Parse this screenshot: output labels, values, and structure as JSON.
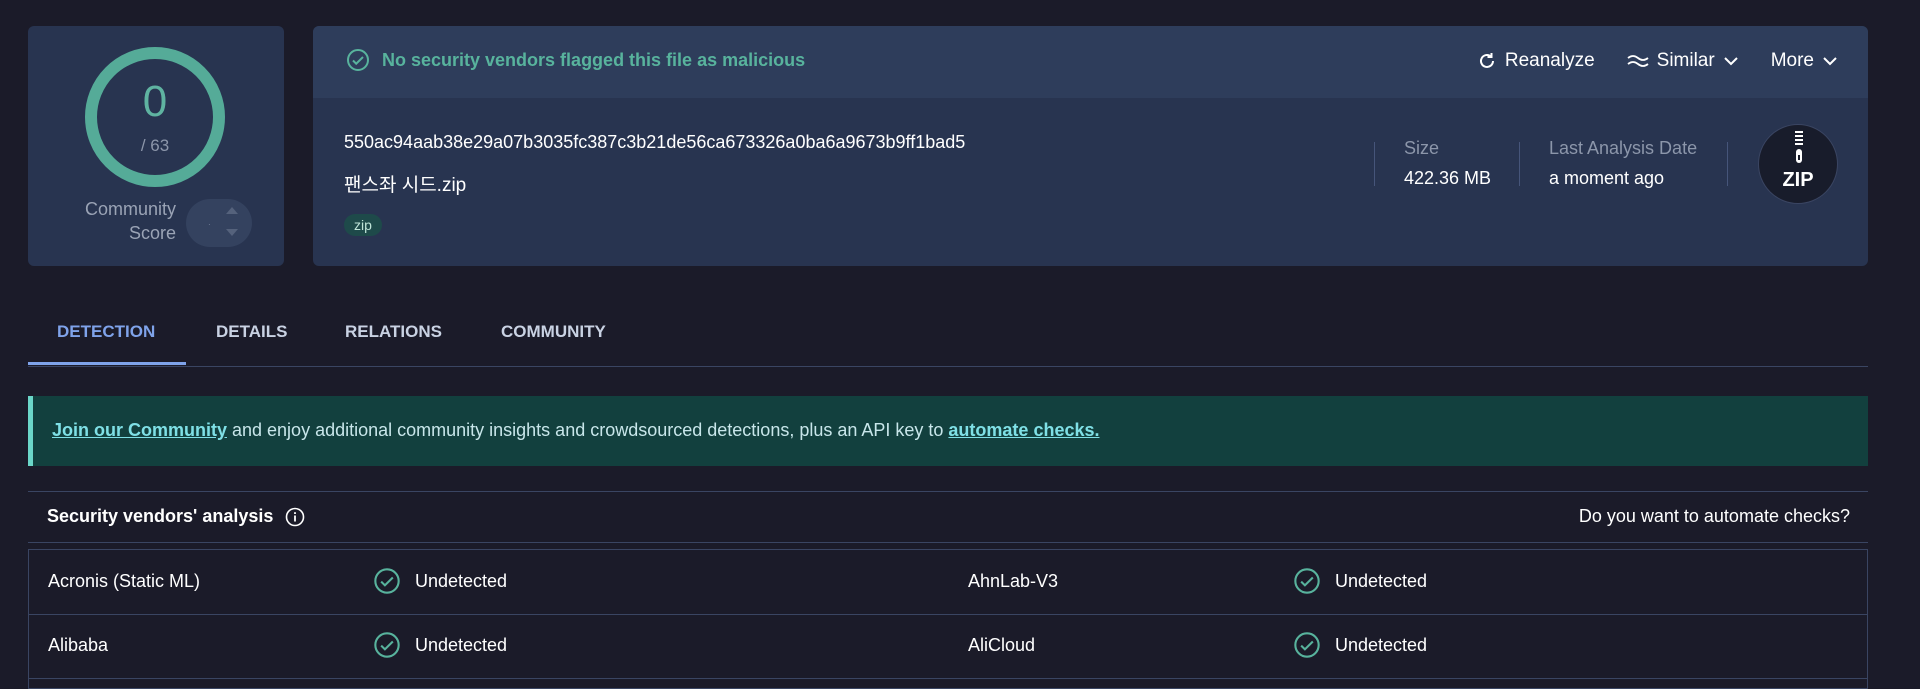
{
  "score": {
    "value": "0",
    "total": "/ 63",
    "community_label_1": "Community",
    "community_label_2": "Score",
    "vote_value": "·"
  },
  "status": {
    "text": "No security vendors flagged this file as malicious",
    "color": "#58b39d"
  },
  "actions": {
    "reanalyze": "Reanalyze",
    "similar": "Similar",
    "more": "More"
  },
  "file": {
    "hash": "550ac94aab38e29a07b3035fc387c3b21de56ca673326a0ba6a9673b9ff1bad5",
    "name": "팬스좌 시드.zip",
    "tag": "zip",
    "size_label": "Size",
    "size_value": "422.36 MB",
    "date_label": "Last Analysis Date",
    "date_value": "a moment ago",
    "type_badge": "ZIP"
  },
  "tabs": [
    "DETECTION",
    "DETAILS",
    "RELATIONS",
    "COMMUNITY"
  ],
  "banner": {
    "link1": "Join our Community",
    "middle": " and enjoy additional community insights and crowdsourced detections, plus an API key to ",
    "link2": "automate checks."
  },
  "vendors": {
    "title": "Security vendors' analysis",
    "automate": "Do you want to automate checks?",
    "rows": [
      {
        "left_name": "Acronis (Static ML)",
        "left_result": "Undetected",
        "right_name": "AhnLab-V3",
        "right_result": "Undetected"
      },
      {
        "left_name": "Alibaba",
        "left_result": "Undetected",
        "right_name": "AliCloud",
        "right_result": "Undetected"
      }
    ]
  },
  "colors": {
    "accent": "#7fa3ea",
    "ok": "#58b39d",
    "panel": "#283450"
  },
  "icons": {
    "status": "check-circle-icon",
    "reanalyze": "refresh-icon",
    "similar": "similar-wave-icon",
    "info": "info-icon",
    "zip": "zipper-icon"
  }
}
